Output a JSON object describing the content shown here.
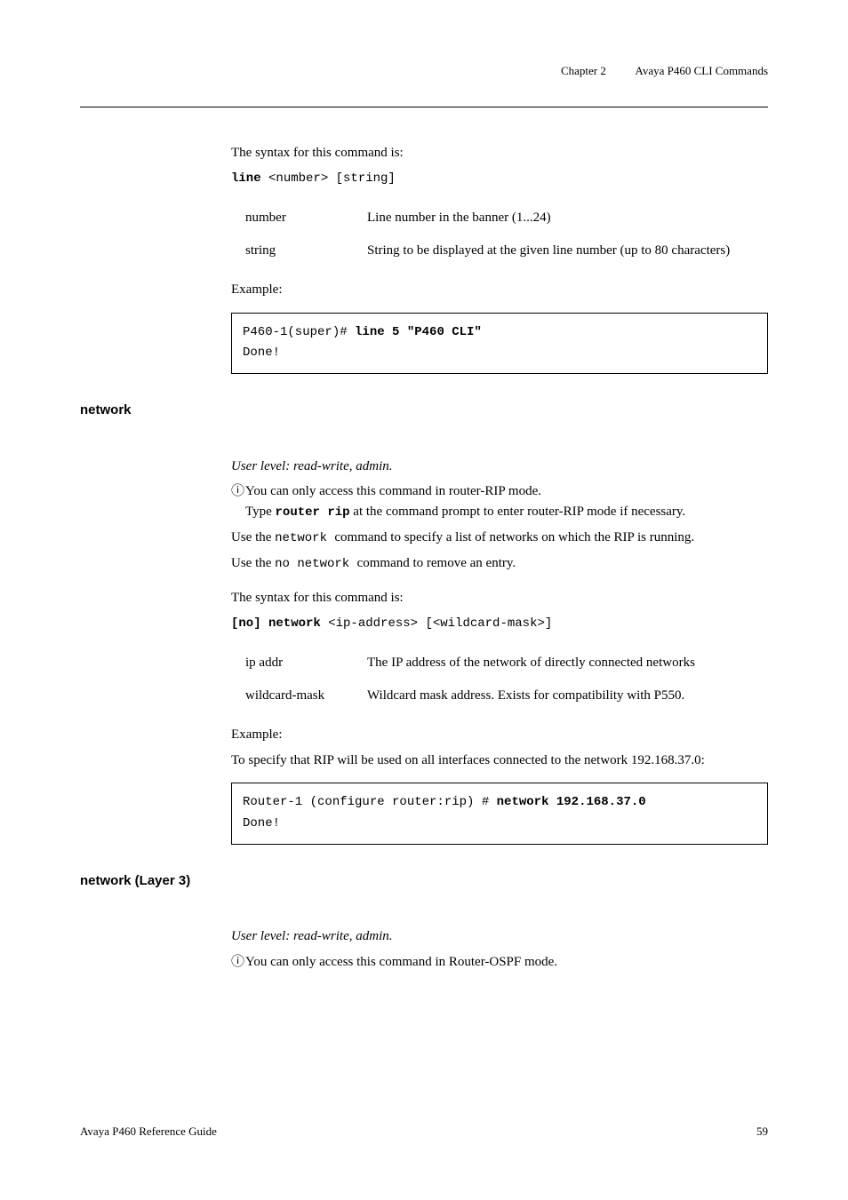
{
  "header": {
    "chapter": "Chapter 2",
    "title": "Avaya P460 CLI Commands"
  },
  "line_section": {
    "syntax_intro": "The syntax for this command is:",
    "syntax_cmd": "line",
    "syntax_args": " <number> [string]",
    "params": {
      "number": {
        "name": "number",
        "desc": "Line number in the banner (1...24)"
      },
      "string": {
        "name": "string",
        "desc": "String to be displayed at the given line number (up to 80 characters)"
      }
    },
    "example_label": "Example:",
    "example_prefix": "P460-1(super)# ",
    "example_cmd": "line 5 \"P460 CLI\"",
    "example_done": "Done!"
  },
  "network_section": {
    "heading": "network",
    "user_level": "User level: read-write, admin.",
    "info_icon": "ⓘ",
    "info1": "You can only access this command in router-RIP mode.",
    "info1b_prefix": "Type ",
    "info1b_cmd": "router rip",
    "info1b_suffix": " at the command prompt to enter router-RIP mode if necessary.",
    "use1_prefix": "Use the ",
    "use1_cmd": " network ",
    "use1_suffix": " command to specify a list of networks on which the RIP is running.",
    "use2_prefix": "Use the ",
    "use2_cmd": " no network ",
    "use2_suffix": "command to remove an entry.",
    "syntax_intro": "The syntax for this command is:",
    "syntax_cmd": "[no] network",
    "syntax_args": " <ip-address> [<wildcard-mask>]",
    "params": {
      "ip_addr": {
        "name": "ip addr",
        "desc": "The IP address of the network of directly connected networks"
      },
      "wildcard": {
        "name": "wildcard-mask",
        "desc": "Wildcard mask address. Exists for compatibility with P550."
      }
    },
    "example_label": "Example:",
    "example_desc": "To specify that RIP will be used on all interfaces connected to the network 192.168.37.0:",
    "example_prefix": "Router-1 (configure router:rip) # ",
    "example_cmd": "network 192.168.37.0",
    "example_done": "Done!"
  },
  "network_l3_section": {
    "heading": "network (Layer 3)",
    "user_level": "User level: read-write, admin.",
    "info_icon": "ⓘ",
    "info1": "You can only access this command in Router-OSPF mode."
  },
  "footer": {
    "left": "Avaya P460 Reference Guide",
    "right": "59"
  }
}
